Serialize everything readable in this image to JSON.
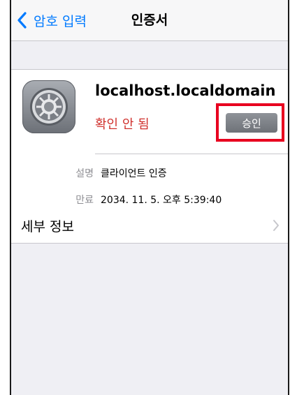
{
  "navbar": {
    "back_label": "암호 입력",
    "title": "인증서"
  },
  "certificate": {
    "icon": "settings-gear-icon",
    "name": "localhost.localdomain",
    "status": "확인 안 됨",
    "approve_label": "승인",
    "description_label": "설명",
    "description_value": "클라이언트 인증",
    "expires_label": "만료",
    "expires_value": "2034. 11. 5. 오후 5:39:40"
  },
  "details": {
    "label": "세부 정보"
  },
  "colors": {
    "accent": "#007aff",
    "status_red": "#d0312d",
    "highlight": "#e8001f",
    "background": "#efeff4"
  }
}
